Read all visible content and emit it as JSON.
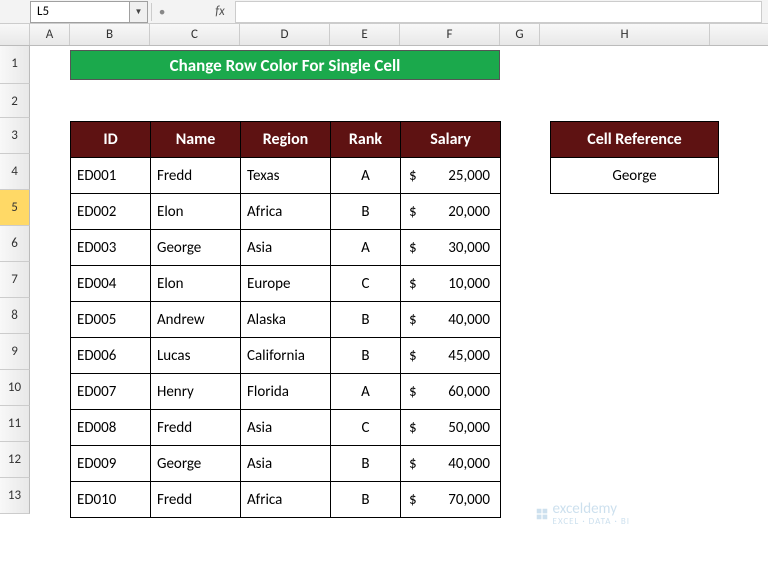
{
  "namebox": {
    "value": "L5"
  },
  "fx": {
    "label": "fx"
  },
  "columns": [
    "A",
    "B",
    "C",
    "D",
    "E",
    "F",
    "G",
    "H"
  ],
  "rows_numbers": [
    "1",
    "2",
    "3",
    "4",
    "5",
    "6",
    "7",
    "8",
    "9",
    "10",
    "11",
    "12",
    "13"
  ],
  "selected_row": 5,
  "title": "Change Row Color For Single Cell",
  "headers": {
    "id": "ID",
    "name": "Name",
    "region": "Region",
    "rank": "Rank",
    "salary": "Salary"
  },
  "rows": [
    {
      "id": "ED001",
      "name": "Fredd",
      "region": "Texas",
      "rank": "A",
      "salary": "25,000"
    },
    {
      "id": "ED002",
      "name": "Elon",
      "region": "Africa",
      "rank": "B",
      "salary": "20,000"
    },
    {
      "id": "ED003",
      "name": "George",
      "region": "Asia",
      "rank": "A",
      "salary": "30,000"
    },
    {
      "id": "ED004",
      "name": "Elon",
      "region": "Europe",
      "rank": "C",
      "salary": "10,000"
    },
    {
      "id": "ED005",
      "name": "Andrew",
      "region": "Alaska",
      "rank": "B",
      "salary": "40,000"
    },
    {
      "id": "ED006",
      "name": "Lucas",
      "region": "California",
      "rank": "B",
      "salary": "45,000"
    },
    {
      "id": "ED007",
      "name": "Henry",
      "region": "Florida",
      "rank": "A",
      "salary": "60,000"
    },
    {
      "id": "ED008",
      "name": "Fredd",
      "region": "Asia",
      "rank": "C",
      "salary": "50,000"
    },
    {
      "id": "ED009",
      "name": "George",
      "region": "Asia",
      "rank": "B",
      "salary": "40,000"
    },
    {
      "id": "ED010",
      "name": "Fredd",
      "region": "Africa",
      "rank": "B",
      "salary": "70,000"
    }
  ],
  "currency": "$",
  "reference": {
    "header": "Cell Reference",
    "value": "George"
  },
  "watermark": {
    "brand": "exceldemy",
    "tag": "EXCEL · DATA · BI"
  }
}
